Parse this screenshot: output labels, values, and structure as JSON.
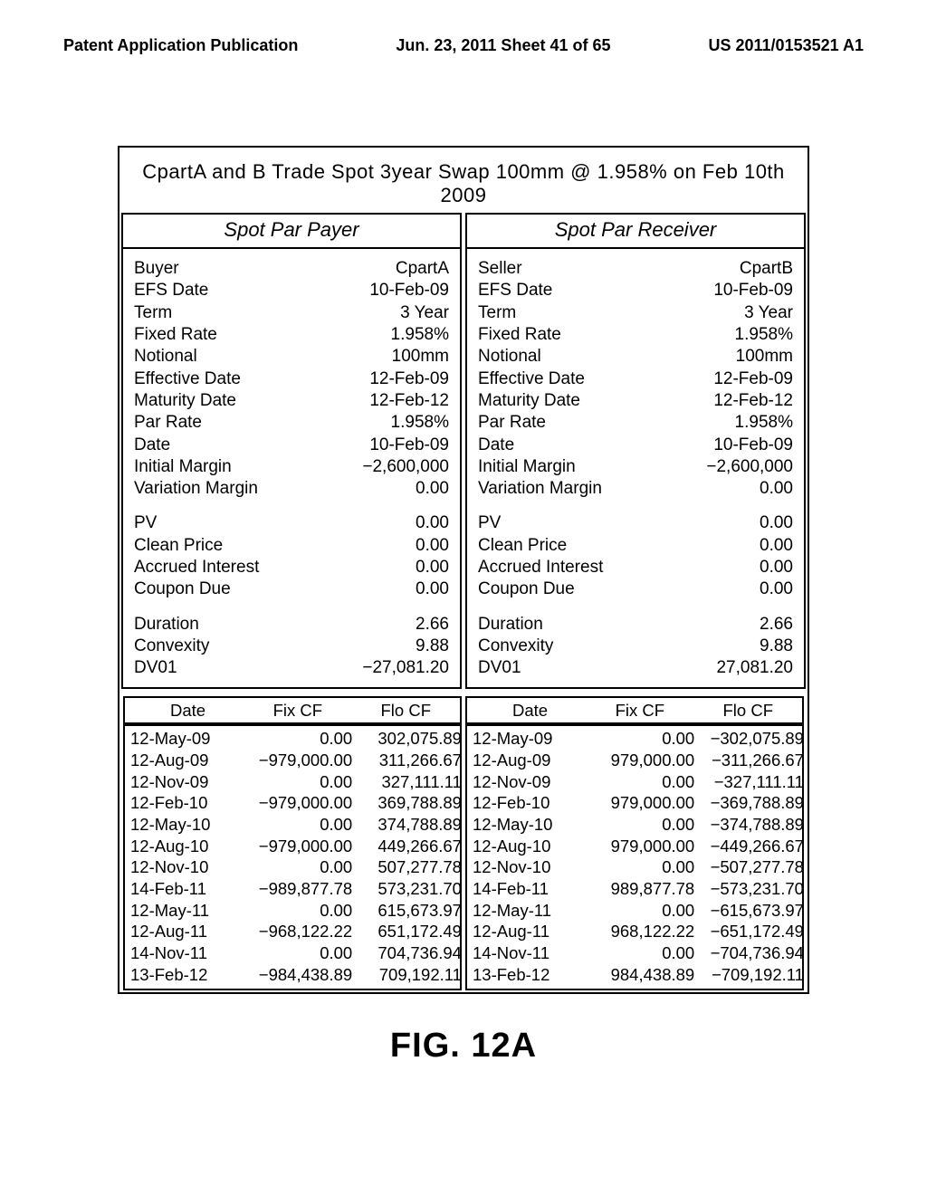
{
  "header": {
    "left": "Patent Application Publication",
    "center": "Jun. 23, 2011  Sheet 41 of 65",
    "right": "US 2011/0153521 A1"
  },
  "figure": {
    "title": "CpartA and B Trade Spot 3year Swap 100mm @ 1.958% on Feb 10th 2009",
    "caption": "FIG. 12A",
    "payer": {
      "panel_title": "Spot Par Payer",
      "kv1": [
        {
          "k": "Buyer",
          "v": "CpartA"
        },
        {
          "k": "EFS Date",
          "v": "10-Feb-09"
        },
        {
          "k": "Term",
          "v": "3 Year"
        },
        {
          "k": "Fixed Rate",
          "v": "1.958%"
        },
        {
          "k": "Notional",
          "v": "100mm"
        },
        {
          "k": "Effective Date",
          "v": "12-Feb-09"
        },
        {
          "k": "Maturity Date",
          "v": "12-Feb-12"
        },
        {
          "k": "Par Rate",
          "v": "1.958%"
        },
        {
          "k": "Date",
          "v": "10-Feb-09"
        },
        {
          "k": "Initial Margin",
          "v": "−2,600,000"
        },
        {
          "k": "Variation Margin",
          "v": "0.00"
        }
      ],
      "kv2": [
        {
          "k": "PV",
          "v": "0.00"
        },
        {
          "k": "Clean Price",
          "v": "0.00"
        },
        {
          "k": "Accrued Interest",
          "v": "0.00"
        },
        {
          "k": "Coupon Due",
          "v": "0.00"
        }
      ],
      "kv3": [
        {
          "k": "Duration",
          "v": "2.66"
        },
        {
          "k": "Convexity",
          "v": "9.88"
        },
        {
          "k": "DV01",
          "v": "−27,081.20"
        }
      ],
      "cf_headers": {
        "date": "Date",
        "fix": "Fix CF",
        "flo": "Flo CF"
      },
      "cf_rows": [
        {
          "date": "12-May-09",
          "fix": "0.00",
          "flo": "302,075.89"
        },
        {
          "date": "12-Aug-09",
          "fix": "−979,000.00",
          "flo": "311,266.67"
        },
        {
          "date": "12-Nov-09",
          "fix": "0.00",
          "flo": "327,111.11"
        },
        {
          "date": "12-Feb-10",
          "fix": "−979,000.00",
          "flo": "369,788.89"
        },
        {
          "date": "12-May-10",
          "fix": "0.00",
          "flo": "374,788.89"
        },
        {
          "date": "12-Aug-10",
          "fix": "−979,000.00",
          "flo": "449,266.67"
        },
        {
          "date": "12-Nov-10",
          "fix": "0.00",
          "flo": "507,277.78"
        },
        {
          "date": "14-Feb-11",
          "fix": "−989,877.78",
          "flo": "573,231.70"
        },
        {
          "date": "12-May-11",
          "fix": "0.00",
          "flo": "615,673.97"
        },
        {
          "date": "12-Aug-11",
          "fix": "−968,122.22",
          "flo": "651,172.49"
        },
        {
          "date": "14-Nov-11",
          "fix": "0.00",
          "flo": "704,736.94"
        },
        {
          "date": "13-Feb-12",
          "fix": "−984,438.89",
          "flo": "709,192.11"
        }
      ]
    },
    "receiver": {
      "panel_title": "Spot Par Receiver",
      "kv1": [
        {
          "k": "Seller",
          "v": "CpartB"
        },
        {
          "k": "EFS Date",
          "v": "10-Feb-09"
        },
        {
          "k": "Term",
          "v": "3 Year"
        },
        {
          "k": "Fixed Rate",
          "v": "1.958%"
        },
        {
          "k": "Notional",
          "v": "100mm"
        },
        {
          "k": "Effective Date",
          "v": "12-Feb-09"
        },
        {
          "k": "Maturity Date",
          "v": "12-Feb-12"
        },
        {
          "k": "Par Rate",
          "v": "1.958%"
        },
        {
          "k": "Date",
          "v": "10-Feb-09"
        },
        {
          "k": "Initial Margin",
          "v": "−2,600,000"
        },
        {
          "k": "Variation Margin",
          "v": "0.00"
        }
      ],
      "kv2": [
        {
          "k": "PV",
          "v": "0.00"
        },
        {
          "k": "Clean Price",
          "v": "0.00"
        },
        {
          "k": "Accrued Interest",
          "v": "0.00"
        },
        {
          "k": "Coupon Due",
          "v": "0.00"
        }
      ],
      "kv3": [
        {
          "k": "Duration",
          "v": "2.66"
        },
        {
          "k": "Convexity",
          "v": "9.88"
        },
        {
          "k": "DV01",
          "v": "27,081.20"
        }
      ],
      "cf_headers": {
        "date": "Date",
        "fix": "Fix CF",
        "flo": "Flo CF"
      },
      "cf_rows": [
        {
          "date": "12-May-09",
          "fix": "0.00",
          "flo": "−302,075.89"
        },
        {
          "date": "12-Aug-09",
          "fix": "979,000.00",
          "flo": "−311,266.67"
        },
        {
          "date": "12-Nov-09",
          "fix": "0.00",
          "flo": "−327,111.11"
        },
        {
          "date": "12-Feb-10",
          "fix": "979,000.00",
          "flo": "−369,788.89"
        },
        {
          "date": "12-May-10",
          "fix": "0.00",
          "flo": "−374,788.89"
        },
        {
          "date": "12-Aug-10",
          "fix": "979,000.00",
          "flo": "−449,266.67"
        },
        {
          "date": "12-Nov-10",
          "fix": "0.00",
          "flo": "−507,277.78"
        },
        {
          "date": "14-Feb-11",
          "fix": "989,877.78",
          "flo": "−573,231.70"
        },
        {
          "date": "12-May-11",
          "fix": "0.00",
          "flo": "−615,673.97"
        },
        {
          "date": "12-Aug-11",
          "fix": "968,122.22",
          "flo": "−651,172.49"
        },
        {
          "date": "14-Nov-11",
          "fix": "0.00",
          "flo": "−704,736.94"
        },
        {
          "date": "13-Feb-12",
          "fix": "984,438.89",
          "flo": "−709,192.11"
        }
      ]
    }
  }
}
